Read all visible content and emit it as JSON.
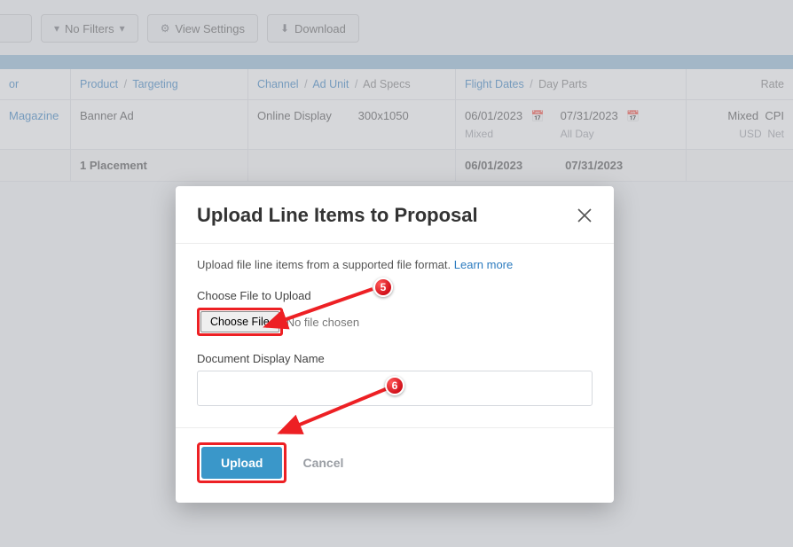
{
  "toolbar": {
    "filters_label": "No Filters",
    "view_label": "View Settings",
    "download_label": "Download"
  },
  "columns": {
    "or": "or",
    "product": "Product",
    "targeting": "Targeting",
    "channel": "Channel",
    "ad_unit": "Ad Unit",
    "ad_specs": "Ad Specs",
    "flight_dates": "Flight Dates",
    "day_parts": "Day Parts",
    "rate": "Rate"
  },
  "rows": [
    {
      "or": "Magazine",
      "product": "Banner Ad",
      "channel": "Online Display",
      "ad_specs": "300x1050",
      "flight_start": "06/01/2023",
      "flight_end": "07/31/2023",
      "freq": "Mixed",
      "day_parts": "All Day",
      "rate_type": "Mixed",
      "rate_unit": "CPI",
      "currency": "USD",
      "gross": "Net"
    }
  ],
  "summary": {
    "placement": "1 Placement",
    "start": "06/01/2023",
    "end": "07/31/2023"
  },
  "modal": {
    "title": "Upload Line Items to Proposal",
    "hint": "Upload file line items from a supported file format.",
    "learn_more": "Learn more",
    "choose_label": "Choose File to Upload",
    "choose_btn": "Choose File",
    "no_file": "No file chosen",
    "doc_label": "Document Display Name",
    "doc_value": "",
    "upload": "Upload",
    "cancel": "Cancel"
  },
  "annotations": {
    "badge5": "5",
    "badge6": "6"
  }
}
